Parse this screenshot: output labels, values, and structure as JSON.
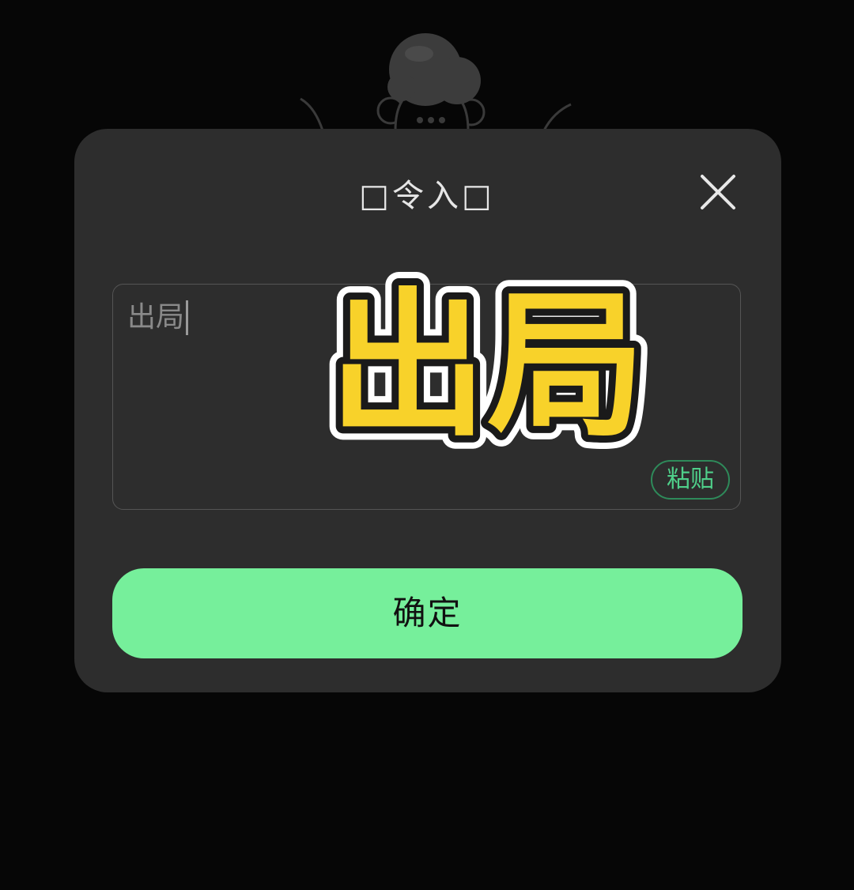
{
  "dialog": {
    "title": "□令入□",
    "close_icon": "close-icon",
    "input": {
      "value": "出局"
    },
    "paste_label": "粘贴",
    "confirm_label": "确定"
  },
  "overlay": {
    "sticker_text": "出局",
    "fill_color": "#f8d22a",
    "outline_color": "#1a1a1a",
    "border_color": "#ffffff"
  },
  "colors": {
    "background": "#060606",
    "dialog": "#2d2d2d",
    "accent_green": "#76ef9b",
    "paste_green": "#4fd08a"
  }
}
